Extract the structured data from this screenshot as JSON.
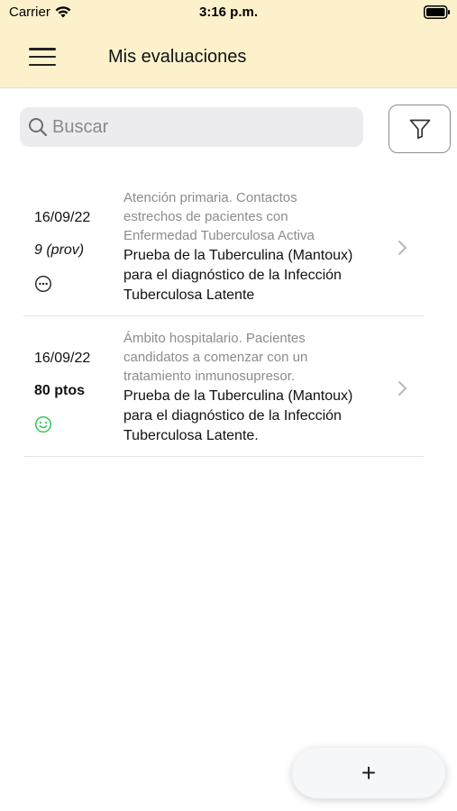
{
  "status_bar": {
    "carrier": "Carrier",
    "time": "3:16 p.m."
  },
  "header": {
    "title": "Mis evaluaciones"
  },
  "search": {
    "placeholder": "Buscar",
    "value": ""
  },
  "evaluations": [
    {
      "date": "16/09/22",
      "score": "9 (prov)",
      "status_icon": "pending-dots-icon",
      "context": "Atención primaria. Contactos\nestrechos de pacientes con\nEnfermedad Tuberculosa Activa",
      "title": "Prueba de la Tuberculina (Mantoux)\npara el diagnóstico de la Infección\nTuberculosa Latente"
    },
    {
      "date": "16/09/22",
      "score": "80 ptos",
      "status_icon": "smiley-face-icon",
      "context": "Ámbito hospitalario. Pacientes\ncandidatos a comenzar con un\ntratamiento inmunosupresor.",
      "title": "Prueba de la Tuberculina (Mantoux)\npara el diagnóstico de la Infección\nTuberculosa Latente."
    }
  ],
  "add_button": {
    "label": "+"
  },
  "colors": {
    "header_bg": "#fdf1cc",
    "context_text": "#8c8c8c",
    "success": "#34c759",
    "search_bg": "#ececee"
  }
}
